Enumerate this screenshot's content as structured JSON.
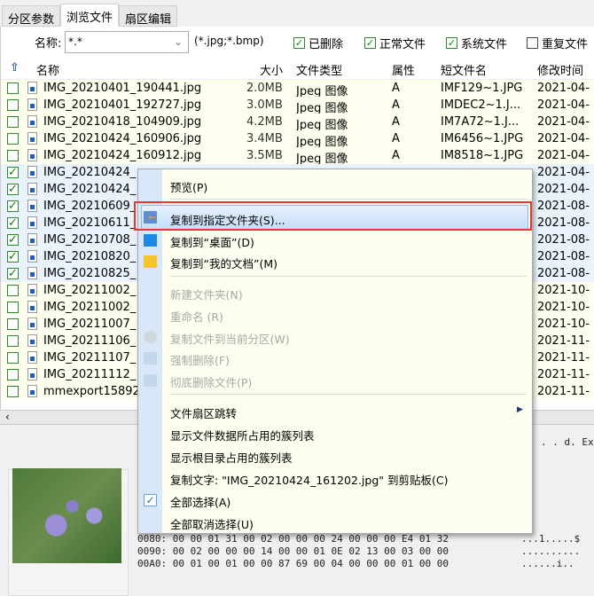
{
  "tabs": [
    "分区参数",
    "浏览文件",
    "扇区编辑"
  ],
  "filter": {
    "label": "名称:",
    "value": "*.*",
    "hint": "(*.jpg;*.bmp)",
    "checks": [
      {
        "label": "已删除",
        "checked": true
      },
      {
        "label": "正常文件",
        "checked": true
      },
      {
        "label": "系统文件",
        "checked": true
      },
      {
        "label": "重复文件",
        "checked": false
      }
    ]
  },
  "columns": {
    "name": "名称",
    "size": "大小",
    "type": "文件类型",
    "attr": "属性",
    "short": "短文件名",
    "mtime": "修改时间"
  },
  "rows": [
    {
      "name": "IMG_20210401_190441.jpg",
      "size": "2.0MB",
      "type": "Jpeg 图像",
      "attr": "A",
      "short": "IMF129~1.JPG",
      "mtime": "2021-04-",
      "checked": false
    },
    {
      "name": "IMG_20210401_192727.jpg",
      "size": "3.0MB",
      "type": "Jpeg 图像",
      "attr": "A",
      "short": "IMDEC2~1.J...",
      "mtime": "2021-04-",
      "checked": false
    },
    {
      "name": "IMG_20210418_104909.jpg",
      "size": "4.2MB",
      "type": "Jpeg 图像",
      "attr": "A",
      "short": "IM7A72~1.J...",
      "mtime": "2021-04-",
      "checked": false
    },
    {
      "name": "IMG_20210424_160906.jpg",
      "size": "3.4MB",
      "type": "Jpeg 图像",
      "attr": "A",
      "short": "IM6456~1.JPG",
      "mtime": "2021-04-",
      "checked": false
    },
    {
      "name": "IMG_20210424_160912.jpg",
      "size": "3.5MB",
      "type": "Jpeg 图像",
      "attr": "A",
      "short": "IM8518~1.JPG",
      "mtime": "2021-04-",
      "checked": false
    },
    {
      "name": "IMG_20210424_",
      "mtime": "2021-04-",
      "checked": true
    },
    {
      "name": "IMG_20210424_",
      "mtime": "2021-04-",
      "checked": true
    },
    {
      "name": "IMG_20210609_",
      "mtime": "2021-08-",
      "checked": true
    },
    {
      "name": "IMG_20210611_",
      "mtime": "2021-08-",
      "checked": true
    },
    {
      "name": "IMG_20210708_",
      "mtime": "2021-08-",
      "checked": true
    },
    {
      "name": "IMG_20210820_",
      "mtime": "2021-08-",
      "checked": true
    },
    {
      "name": "IMG_20210825_",
      "mtime": "2021-08-",
      "checked": true
    },
    {
      "name": "IMG_20211002_",
      "mtime": "2021-10-",
      "checked": false
    },
    {
      "name": "IMG_20211002_",
      "mtime": "2021-10-",
      "checked": false
    },
    {
      "name": "IMG_20211007_",
      "mtime": "2021-10-",
      "checked": false
    },
    {
      "name": "IMG_20211106_",
      "mtime": "2021-11-",
      "checked": false
    },
    {
      "name": "IMG_20211107_",
      "mtime": "2021-11-",
      "checked": false
    },
    {
      "name": "IMG_20211112_",
      "mtime": "2021-11-",
      "checked": false
    },
    {
      "name": "mmexport15892",
      "mtime": "2021-11-",
      "checked": false
    }
  ],
  "menu": {
    "preview": "预览(P)",
    "copy_to_folder": "复制到指定文件夹(S)...",
    "copy_desktop": "复制到“桌面”(D)",
    "copy_docs": "复制到“我的文档”(M)",
    "new_folder": "新建文件夹(N)",
    "rename": "重命名 (R)",
    "copy_partition": "复制文件到当前分区(W)",
    "force_delete": "强制删除(F)",
    "wipe_delete": "彻底删除文件(P)",
    "sector_jump": "文件扇区跳转",
    "show_clusters": "显示文件数据所占用的簇列表",
    "show_root_clusters": "显示根目录占用的簇列表",
    "copy_text": "复制文字: \"IMG_20210424_161202.jpg\" 到剪贴板(C)",
    "select_all": "全部选择(A)",
    "deselect_all": "全部取消选择(U)"
  },
  "hex": {
    "ascii_top": ". . d. Exif",
    "lines": [
      "0080: 00 00 01 31 00 02 00 00 00 24 00 00 00 E4 01 32",
      "0090: 00 02 00 00 00 14 00 00 01 0E 02 13 00 03 00 00",
      "00A0: 00 01 00 01 00 00 87 69 00 04 00 00 00 01 00 00"
    ],
    "ascii": [
      "...1.....$",
      "..........",
      "......i.."
    ]
  },
  "colors": {
    "highlight_border": "#e53935",
    "check": "#1a7a1a"
  }
}
